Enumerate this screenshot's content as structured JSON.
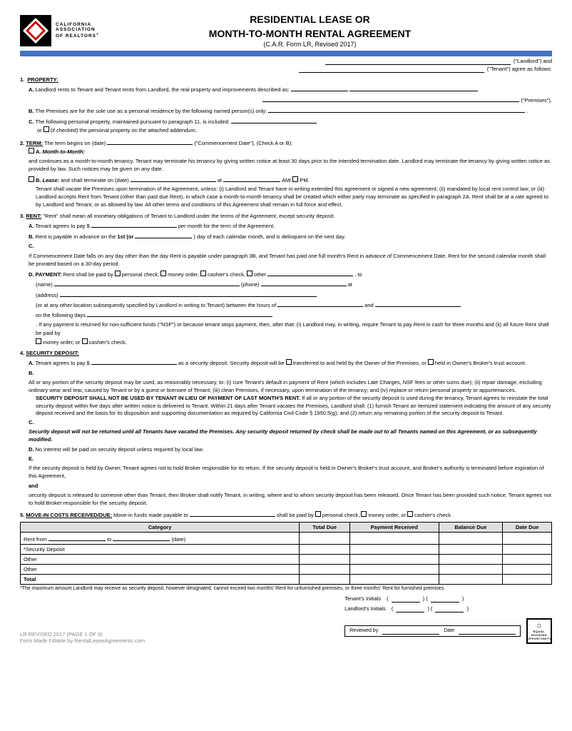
{
  "header": {
    "logo_line1": "CALIFORNIA",
    "logo_line2": "ASSOCIATION",
    "logo_line3": "OF REALTORS",
    "logo_reg": "®",
    "title_line1": "RESIDENTIAL LEASE OR",
    "title_line2": "MONTH-TO-MONTH RENTAL AGREEMENT",
    "title_line3": "(C.A.R. Form LR, Revised 2017)"
  },
  "sig": {
    "landlord_label": "(\"Landlord\") and",
    "tenant_label": "(\"Tenant\") agree as follows:"
  },
  "sections": {
    "s1": {
      "num": "1.",
      "title": "PROPERTY:",
      "A": "Landlord rents to Tenant and Tenant rents from Landlord, the real property and improvements described as:",
      "A_end": "(\"Premises\").",
      "B": "The Premises are for the sole use as a personal residence by the following named person(s) only:",
      "C": "The following personal property, maintained pursuant to paragraph 11, is included:",
      "C_or": "or",
      "C_check": "(if checked) the personal property on the attached addendum."
    },
    "s2": {
      "num": "2.",
      "title": "TERM:",
      "intro": "The term begins on (date)",
      "intro2": "(\"Commencement Date\"), (Check A or B):",
      "A_label": "A.",
      "A_title": "Month-to-Month:",
      "A_text": "and continues as a month-to-month tenancy. Tenant may terminate his tenancy by giving written notice at least 30 days prior to the intended termination date. Landlord may terminate the tenancy by giving written notice as provided by law. Such notices may be given on any date.",
      "B_label": "B.",
      "B_title": "Lease:",
      "B_text": "and shall terminate on (date)",
      "B_at": "at",
      "B_ampm": "AM/",
      "B_pm": "PM.",
      "B_body": "Tenant shall vacate the Premises upon termination of the Agreement, unless: (i) Landlord and Tenant have in writing extended this agreement or signed a new agreement; (ii) mandated by local rent control law; or (iii) Landlord accepts Rent from Tenant (other than past due Rent), in which case a month-to-month tenancy shall be created which either party may terminate as specified in paragraph 2A. Rent shall be at a rate agreed to by Landlord and Tenant, or as allowed by law. All other terms and conditions of this Agreement shall remain in full force and effect."
    },
    "s3": {
      "num": "3.",
      "title": "RENT:",
      "intro": "\"Rent\" shall mean all monetary obligations of Tenant to Landlord under the terms of the Agreement, except security deposit.",
      "A": "Tenant agrees to pay $",
      "A_end": "per month for the term of the Agreement.",
      "B": "Rent is payable in advance on the",
      "B_bold": "1st (or",
      "B_end": ") day of each calendar month, and is delinquent on the next day.",
      "C": "If Commencement Date falls on any day other than the day Rent is payable under paragraph 3B, and Tenant has paid one full month's Rent in advance of Commencement Date, Rent for the second calendar month shall be prorated based on a 30-day period.",
      "D_label": "D.",
      "D_title": "PAYMENT:",
      "D_text": "Rent shall be paid by",
      "D_personal": "personal check,",
      "D_money": "money order,",
      "D_cashier": "cashier's check,",
      "D_other": "other",
      "D_to": ", to",
      "D_name": "(name)",
      "D_phone": "(phone)",
      "D_at": "at",
      "D_address": "(address)",
      "D_or": "(or at any other location subsequently specified by Landlord in writing to Tenant) between the hours of",
      "D_and": "and",
      "D_days": "on the following days",
      "D_nsf": ". If any payment is returned for non-sufficient funds (\"NSF\") or because tenant stops payment, then, after that: (i) Landlord may, in writing, require Tenant to pay Rent in cash for three months and (ii) all future Rent shall be paid by",
      "D_money2": "money order, or",
      "D_cashier2": "cashier's check."
    },
    "s4": {
      "num": "4.",
      "title": "SECURITY DEPOSIT:",
      "A": "Tenant agrees to pay $",
      "A_mid": "as a security deposit. Security deposit will be",
      "A_transferred": "transferred to and held by the Owner of the Premises, or",
      "A_held": "held in Owner's Broker's trust account.",
      "B": "All or any portion of the security deposit may be used, as reasonably necessary, to: (i) cure Tenant's default in payment of Rent (which includes Late Charges, NSF fees or other sums due); (ii) repair damage, excluding ordinary wear and tear, caused by Tenant or by a guest or licensee of Tenant; (iii) clean Premises, if necessary, upon termination of the tenancy; and (iv) replace or return personal property or appurtenances.",
      "B_bold": "SECURITY DEPOSIT SHALL NOT BE USED BY TENANT IN LIEU OF PAYMENT OF LAST MONTH'S RENT.",
      "B_cont": "If all or any portion of the security deposit is used during the tenancy, Tenant agrees to reinstate the total security deposit within five days after written notice is delivered to Tenant. Within 21 days after Tenant vacates the Premises, Landlord shall: (1) furnish Tenant an itemized statement indicating the amount of any security deposit received and the basis for its disposition and supporting documentation as required by California Civil Code § 1950.5(g); and (2) return any remaining portion of the security deposit to Tenant.",
      "C": "Security deposit will not be returned until all Tenants have vacated the Premises. Any security deposit returned by check shall be made out to all Tenants named on this Agreement, or as subsequently modified.",
      "D": "No interest will be paid on security deposit unless required by local law.",
      "E": "If the security deposit is held by Owner, Tenant agrees not to hold Broker responsible for its return. If the security deposit is held in Owner's Broker's trust account, and Broker's authority is terminated before expiration of this Agreement,",
      "E_bold": "and",
      "E_cont": "security deposit is released to someone other than Tenant, then Broker shall notify Tenant, in writing, where and to whom security deposit has been released. Once Tenant has been provided such notice, Tenant agrees not to hold Broker responsible for the security deposit."
    },
    "s5": {
      "num": "5.",
      "title": "MOVE-IN COSTS RECEIVED/DUE:",
      "intro": "Move-in funds made payable to",
      "intro2": "shall be paid by",
      "personal": "personal check,",
      "money": "money order, or",
      "cashier": "cashier's check."
    }
  },
  "table": {
    "headers": [
      "Category",
      "Total Due",
      "Payment Received",
      "Balance Due",
      "Date Due"
    ],
    "rows": [
      [
        "Rent from _____ to _____ (date)",
        "",
        "",
        "",
        ""
      ],
      [
        "*Security Deposit",
        "",
        "",
        "",
        ""
      ],
      [
        "Other",
        "",
        "",
        "",
        ""
      ],
      [
        "Other",
        "",
        "",
        "",
        ""
      ],
      [
        "Total",
        "",
        "",
        "",
        ""
      ]
    ]
  },
  "footnote": "*The maximum amount Landlord may receive as security deposit, however designated, cannot exceed two months' Rent for unfurnished premises, or three months' Rent for furnished premises.",
  "footer": {
    "revised": "LR REVISED 2017 (PAGE 1 OF 6)",
    "fillable": "Form Made Fillable by RentalLeaseAgreements.com",
    "tenants_initials": "Tenant's Initials",
    "landlords_initials": "Landlord's Initials",
    "reviewed_by": "Reviewed by",
    "date_label": "Date"
  }
}
